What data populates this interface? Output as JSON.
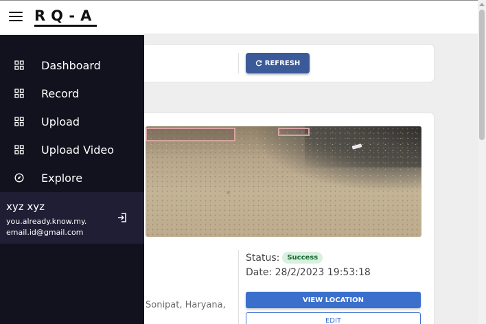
{
  "header": {
    "brand": "RQ-A"
  },
  "toolbar": {
    "refresh_label": "REFRESH"
  },
  "sidebar": {
    "items": [
      {
        "label": "Dashboard",
        "icon": "grid-icon"
      },
      {
        "label": "Record",
        "icon": "grid-icon"
      },
      {
        "label": "Upload",
        "icon": "grid-icon"
      },
      {
        "label": "Upload Video",
        "icon": "grid-icon"
      },
      {
        "label": "Explore",
        "icon": "compass-icon"
      }
    ],
    "user": {
      "name": "xyz xyz",
      "email": "you.already.know.my.email.id@gmail.com"
    }
  },
  "record": {
    "status_label": "Status:",
    "status_value": "Success",
    "date_label": "Date:",
    "date_value": "28/2/2023 19:53:18",
    "address_fragment": "Sonipat, Haryana,",
    "view_location_label": "VIEW LOCATION",
    "edit_label": "EDIT"
  },
  "colors": {
    "sidebar_bg": "#12121e",
    "user_box_bg": "#1f1e35",
    "primary": "#3a6fcc",
    "refresh_bg": "#3b5a9a",
    "success_bg": "#d6f1de",
    "success_text": "#1e6b35"
  }
}
